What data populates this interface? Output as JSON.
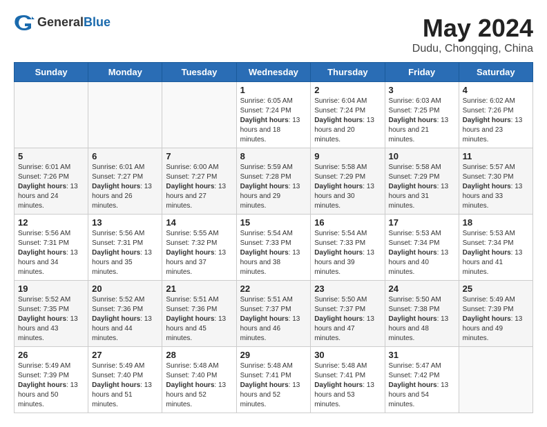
{
  "header": {
    "logo_general": "General",
    "logo_blue": "Blue",
    "month_year": "May 2024",
    "location": "Dudu, Chongqing, China"
  },
  "weekdays": [
    "Sunday",
    "Monday",
    "Tuesday",
    "Wednesday",
    "Thursday",
    "Friday",
    "Saturday"
  ],
  "weeks": [
    [
      {
        "day": "",
        "info": ""
      },
      {
        "day": "",
        "info": ""
      },
      {
        "day": "",
        "info": ""
      },
      {
        "day": "1",
        "info": "Sunrise: 6:05 AM\nSunset: 7:24 PM\nDaylight: 13 hours and 18 minutes."
      },
      {
        "day": "2",
        "info": "Sunrise: 6:04 AM\nSunset: 7:24 PM\nDaylight: 13 hours and 20 minutes."
      },
      {
        "day": "3",
        "info": "Sunrise: 6:03 AM\nSunset: 7:25 PM\nDaylight: 13 hours and 21 minutes."
      },
      {
        "day": "4",
        "info": "Sunrise: 6:02 AM\nSunset: 7:26 PM\nDaylight: 13 hours and 23 minutes."
      }
    ],
    [
      {
        "day": "5",
        "info": "Sunrise: 6:01 AM\nSunset: 7:26 PM\nDaylight: 13 hours and 24 minutes."
      },
      {
        "day": "6",
        "info": "Sunrise: 6:01 AM\nSunset: 7:27 PM\nDaylight: 13 hours and 26 minutes."
      },
      {
        "day": "7",
        "info": "Sunrise: 6:00 AM\nSunset: 7:27 PM\nDaylight: 13 hours and 27 minutes."
      },
      {
        "day": "8",
        "info": "Sunrise: 5:59 AM\nSunset: 7:28 PM\nDaylight: 13 hours and 29 minutes."
      },
      {
        "day": "9",
        "info": "Sunrise: 5:58 AM\nSunset: 7:29 PM\nDaylight: 13 hours and 30 minutes."
      },
      {
        "day": "10",
        "info": "Sunrise: 5:58 AM\nSunset: 7:29 PM\nDaylight: 13 hours and 31 minutes."
      },
      {
        "day": "11",
        "info": "Sunrise: 5:57 AM\nSunset: 7:30 PM\nDaylight: 13 hours and 33 minutes."
      }
    ],
    [
      {
        "day": "12",
        "info": "Sunrise: 5:56 AM\nSunset: 7:31 PM\nDaylight: 13 hours and 34 minutes."
      },
      {
        "day": "13",
        "info": "Sunrise: 5:56 AM\nSunset: 7:31 PM\nDaylight: 13 hours and 35 minutes."
      },
      {
        "day": "14",
        "info": "Sunrise: 5:55 AM\nSunset: 7:32 PM\nDaylight: 13 hours and 37 minutes."
      },
      {
        "day": "15",
        "info": "Sunrise: 5:54 AM\nSunset: 7:33 PM\nDaylight: 13 hours and 38 minutes."
      },
      {
        "day": "16",
        "info": "Sunrise: 5:54 AM\nSunset: 7:33 PM\nDaylight: 13 hours and 39 minutes."
      },
      {
        "day": "17",
        "info": "Sunrise: 5:53 AM\nSunset: 7:34 PM\nDaylight: 13 hours and 40 minutes."
      },
      {
        "day": "18",
        "info": "Sunrise: 5:53 AM\nSunset: 7:34 PM\nDaylight: 13 hours and 41 minutes."
      }
    ],
    [
      {
        "day": "19",
        "info": "Sunrise: 5:52 AM\nSunset: 7:35 PM\nDaylight: 13 hours and 43 minutes."
      },
      {
        "day": "20",
        "info": "Sunrise: 5:52 AM\nSunset: 7:36 PM\nDaylight: 13 hours and 44 minutes."
      },
      {
        "day": "21",
        "info": "Sunrise: 5:51 AM\nSunset: 7:36 PM\nDaylight: 13 hours and 45 minutes."
      },
      {
        "day": "22",
        "info": "Sunrise: 5:51 AM\nSunset: 7:37 PM\nDaylight: 13 hours and 46 minutes."
      },
      {
        "day": "23",
        "info": "Sunrise: 5:50 AM\nSunset: 7:37 PM\nDaylight: 13 hours and 47 minutes."
      },
      {
        "day": "24",
        "info": "Sunrise: 5:50 AM\nSunset: 7:38 PM\nDaylight: 13 hours and 48 minutes."
      },
      {
        "day": "25",
        "info": "Sunrise: 5:49 AM\nSunset: 7:39 PM\nDaylight: 13 hours and 49 minutes."
      }
    ],
    [
      {
        "day": "26",
        "info": "Sunrise: 5:49 AM\nSunset: 7:39 PM\nDaylight: 13 hours and 50 minutes."
      },
      {
        "day": "27",
        "info": "Sunrise: 5:49 AM\nSunset: 7:40 PM\nDaylight: 13 hours and 51 minutes."
      },
      {
        "day": "28",
        "info": "Sunrise: 5:48 AM\nSunset: 7:40 PM\nDaylight: 13 hours and 52 minutes."
      },
      {
        "day": "29",
        "info": "Sunrise: 5:48 AM\nSunset: 7:41 PM\nDaylight: 13 hours and 52 minutes."
      },
      {
        "day": "30",
        "info": "Sunrise: 5:48 AM\nSunset: 7:41 PM\nDaylight: 13 hours and 53 minutes."
      },
      {
        "day": "31",
        "info": "Sunrise: 5:47 AM\nSunset: 7:42 PM\nDaylight: 13 hours and 54 minutes."
      },
      {
        "day": "",
        "info": ""
      }
    ]
  ]
}
